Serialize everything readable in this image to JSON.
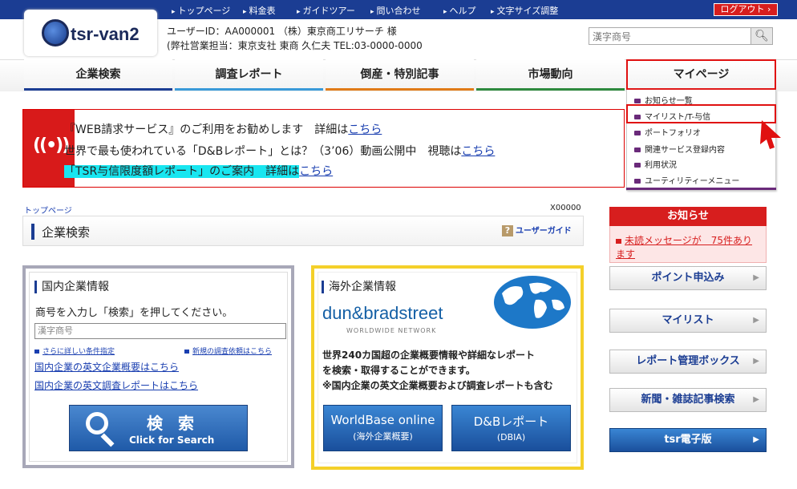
{
  "topnav": {
    "items": [
      "トップページ",
      "料金表",
      "ガイドツアー",
      "問い合わせ",
      "ヘルプ",
      "文字サイズ調整"
    ],
    "logout": "ログアウト"
  },
  "header": {
    "logo_text": "tsr-van2",
    "user_line1": "ユーザーID：AA000001 （株）東京商工リサーチ 様",
    "user_line2": "(弊社営業担当：東京支社 東商 久仁夫 TEL:03-0000-0000",
    "search_placeholder": "漢字商号"
  },
  "mainnav": {
    "tabs": [
      {
        "label": "企業検索",
        "color": "#1b3d93"
      },
      {
        "label": "調査レポート",
        "color": "#3a9ad8"
      },
      {
        "label": "倒産・特別記事",
        "color": "#e07b18"
      },
      {
        "label": "市場動向",
        "color": "#2e8a3e"
      },
      {
        "label": "マイページ",
        "color": "#6a2a7a"
      }
    ]
  },
  "dropdown": {
    "items": [
      "お知らせ一覧",
      "マイリスト/T-与信",
      "ポートフォリオ",
      "関連サービス登録内容",
      "利用状況",
      "ユーティリティーメニュー"
    ]
  },
  "banner": {
    "line1_text": "『WEB請求サービス』のご利用をお勧めします　詳細は",
    "line1_link": "こちら",
    "line2_text": "世界で最も使われている「D&Bレポート」とは？（3’06）動画公開中　視聴は",
    "line2_link": "こちら",
    "line3_text": "「TSR与信限度額レポート」のご案内　詳細は",
    "line3_link": "こちら"
  },
  "breadcrumb": "トップページ",
  "page_code": "X00000",
  "page_title": "企業検索",
  "user_guide": "ユーザーガイド",
  "domestic": {
    "title": "国内企業情報",
    "instruction": "商号を入力し「検索」を押してください。",
    "placeholder": "漢字商号",
    "link_detail": "さらに詳しい条件指定",
    "link_new": "新規の調査依頼はこちら",
    "link_en_summary": "国内企業の英文企業概要はこちら",
    "link_en_report": "国内企業の英文調査レポートはこちら",
    "search_label": "検 索",
    "search_sub": "Click for Search"
  },
  "overseas": {
    "title": "海外企業情報",
    "dnb_logo": "dun&bradstreet",
    "dnb_sub": "WORLDWIDE NETWORK",
    "desc1": "世界240カ国超の企業概要情報や詳細なレポート",
    "desc2": "を検索・取得することができます。",
    "desc3": "※国内企業の英文企業概要および調査レポートも含む",
    "btn1_a": "WorldBase online",
    "btn1_b": "(海外企業概要)",
    "btn2_a": "D&Bレポート",
    "btn2_b": "(DBIA)"
  },
  "news": {
    "title": "お知らせ",
    "message": "未読メッセージが　75件あります"
  },
  "rightbuttons": [
    "ポイント申込み",
    "マイリスト",
    "レポート管理ボックス",
    "新聞・雑誌記事検索",
    "tsr電子版"
  ]
}
